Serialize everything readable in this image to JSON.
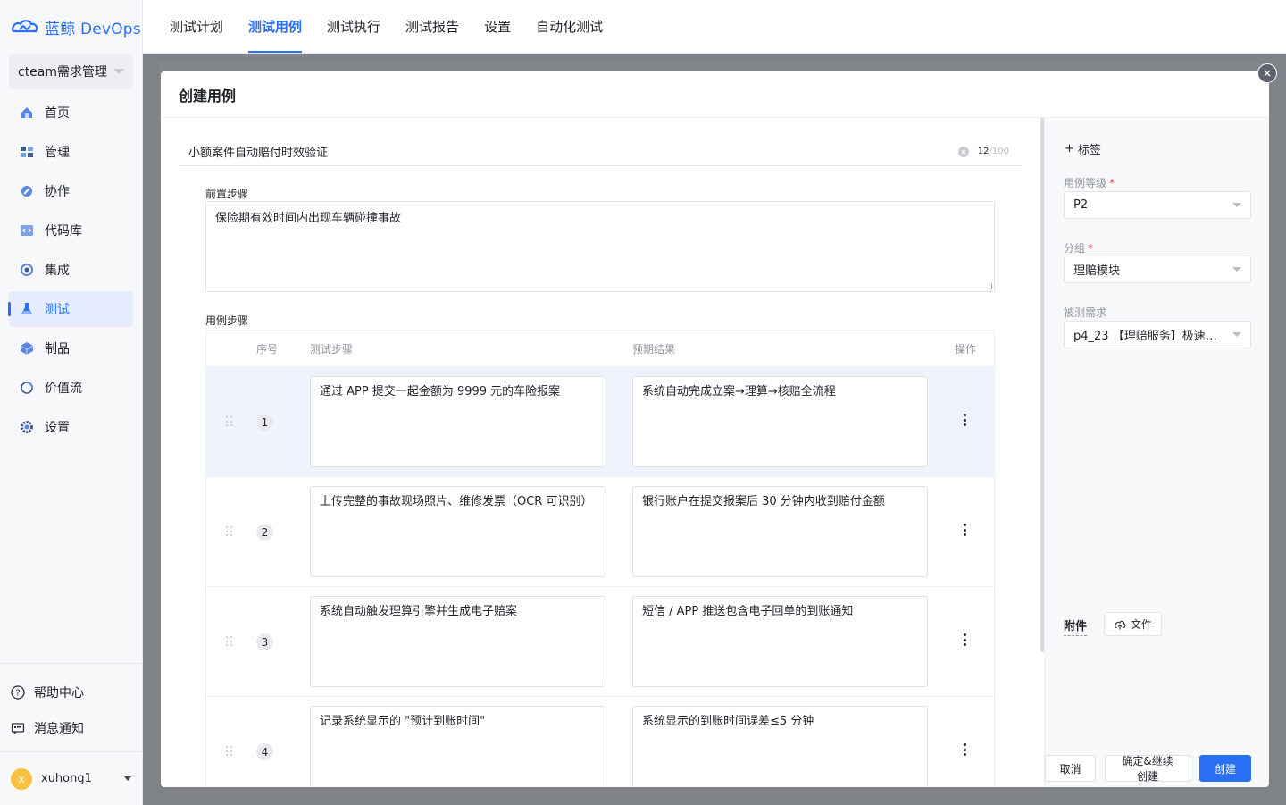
{
  "brand": {
    "name": "蓝鲸 DevOps",
    "color": "#2b6ff5"
  },
  "sidebar": {
    "project": "cteam需求管理",
    "items": [
      {
        "label": "首页",
        "icon": "home-icon"
      },
      {
        "label": "管理",
        "icon": "manage-icon"
      },
      {
        "label": "协作",
        "icon": "collaborate-icon"
      },
      {
        "label": "代码库",
        "icon": "code-repo-icon"
      },
      {
        "label": "集成",
        "icon": "integration-icon"
      },
      {
        "label": "测试",
        "icon": "flask-icon",
        "active": true
      },
      {
        "label": "制品",
        "icon": "artifact-icon"
      },
      {
        "label": "价值流",
        "icon": "value-stream-icon"
      },
      {
        "label": "设置",
        "icon": "gear-icon"
      }
    ],
    "help": "帮助中心",
    "notifications": "消息通知",
    "user": {
      "name": "xuhong1",
      "initial": "x"
    }
  },
  "top_tabs": [
    "测试计划",
    "测试用例",
    "测试执行",
    "测试报告",
    "设置",
    "自动化测试"
  ],
  "active_tab": "测试用例",
  "modal": {
    "title": "创建用例",
    "case_title": "小额案件自动赔付时效验证",
    "title_count": "12",
    "title_max": "/100",
    "precondition_label": "前置步骤",
    "precondition_value": "保险期有效时间内出现车辆碰撞事故",
    "steps_label": "用例步骤",
    "columns": {
      "seq": "序号",
      "step": "测试步骤",
      "expected": "预期结果",
      "action": "操作"
    },
    "steps": [
      {
        "seq": "1",
        "step": "通过 APP 提交一起金额为 9999 元的车险报案",
        "expected": "系统自动完成立案→理算→核赔全流程"
      },
      {
        "seq": "2",
        "step": "上传完整的事故现场照片、维修发票（OCR 可识别）",
        "expected": "银行账户在提交报案后 30 分钟内收到赔付金额"
      },
      {
        "seq": "3",
        "step": "系统自动触发理算引擎并生成电子赔案",
        "expected": "短信 / APP 推送包含电子回单的到账通知"
      },
      {
        "seq": "4",
        "step": "记录系统显示的 \"预计到账时间\"",
        "expected": "系统显示的到账时间误差≤5 分钟"
      }
    ],
    "side": {
      "tag_button": "标签",
      "level_label": "用例等级",
      "level_value": "P2",
      "group_label": "分组",
      "group_value": "理赔模块",
      "req_label": "被测需求",
      "req_value": "p4_23 【理赔服务】极速赔…",
      "attach_label": "附件",
      "file_button": "文件"
    },
    "buttons": {
      "cancel": "取消",
      "confirm_continue": "确定&继续创建",
      "create": "创建"
    }
  }
}
